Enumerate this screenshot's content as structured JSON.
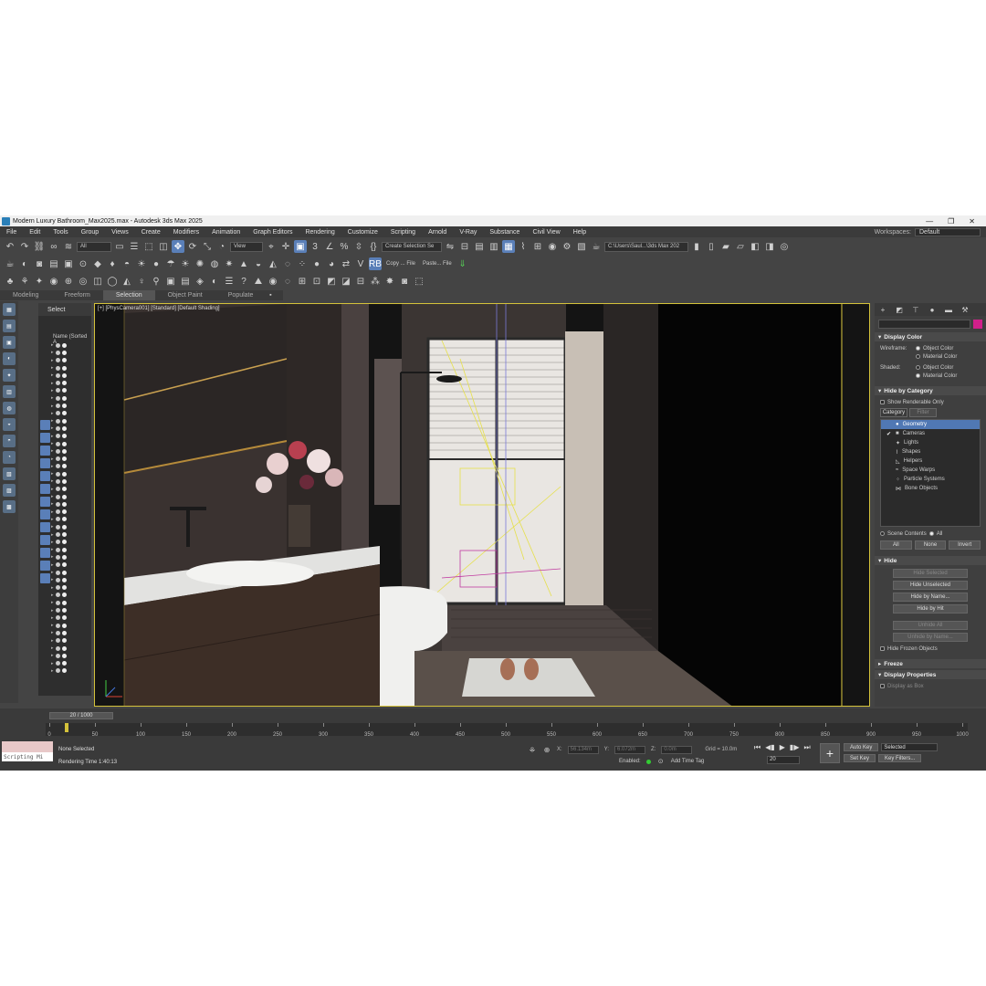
{
  "window": {
    "title": "Modern Luxury Bathroom_Max2025.max - Autodesk 3ds Max 2025",
    "minimize": "—",
    "maximize": "❐",
    "close": "✕"
  },
  "menu": {
    "items": [
      "File",
      "Edit",
      "Tools",
      "Group",
      "Views",
      "Create",
      "Modifiers",
      "Animation",
      "Graph Editors",
      "Rendering",
      "Customize",
      "Scripting",
      "Arnold",
      "V-Ray",
      "Substance",
      "Civil View",
      "Help"
    ],
    "workspaces_label": "Workspaces:",
    "workspaces_value": "Default"
  },
  "toolbar": {
    "selection_filter": "All",
    "reference_coord": "View",
    "named_selection": "Create Selection Se",
    "path": "C:\\Users\\Saul...\\3ds Max 202",
    "copy_label": "Copy ... File",
    "paste_label": "Paste... File",
    "rb_label": "RB"
  },
  "ribbon": {
    "tabs": [
      "Modeling",
      "Freeform",
      "Selection",
      "Object Paint",
      "Populate"
    ],
    "active": "Selection"
  },
  "scene_explorer": {
    "header": "Select",
    "column": "Name (Sorted A"
  },
  "viewport": {
    "label": "[+] [PhysCamera001] [Standard] [Default Shading]"
  },
  "command_panel": {
    "display_color": {
      "title": "Display Color",
      "wireframe_label": "Wireframe:",
      "shaded_label": "Shaded:",
      "object_color": "Object Color",
      "material_color": "Material Color"
    },
    "hide_by_category": {
      "title": "Hide by Category",
      "show_renderable": "Show Renderable Only",
      "tab_category": "Category",
      "tab_filter": "Filter",
      "items": [
        {
          "label": "Geometry",
          "checked": false,
          "selected": true,
          "icon": "●"
        },
        {
          "label": "Cameras",
          "checked": true,
          "selected": false,
          "icon": "■"
        },
        {
          "label": "Lights",
          "checked": false,
          "selected": false,
          "icon": "✦"
        },
        {
          "label": "Shapes",
          "checked": false,
          "selected": false,
          "icon": "⌇"
        },
        {
          "label": "Helpers",
          "checked": false,
          "selected": false,
          "icon": "◺"
        },
        {
          "label": "Space Warps",
          "checked": false,
          "selected": false,
          "icon": "≈"
        },
        {
          "label": "Particle Systems",
          "checked": false,
          "selected": false,
          "icon": "⁘"
        },
        {
          "label": "Bone Objects",
          "checked": false,
          "selected": false,
          "icon": "⋈"
        }
      ],
      "scene_contents": "Scene Contents",
      "all_radio": "All",
      "btn_all": "All",
      "btn_none": "None",
      "btn_invert": "Invert"
    },
    "hide": {
      "title": "Hide",
      "hide_selected": "Hide Selected",
      "hide_unselected": "Hide Unselected",
      "hide_by_name": "Hide by Name...",
      "hide_by_hit": "Hide by Hit",
      "unhide_all": "Unhide All",
      "unhide_by_name": "Unhide by Name...",
      "hide_frozen": "Hide Frozen Objects"
    },
    "freeze": {
      "title": "Freeze"
    },
    "display_properties": {
      "title": "Display Properties",
      "display_as_box": "Display as Box"
    }
  },
  "timeline": {
    "slider": "20 / 1000",
    "ticks": [
      "0",
      "50",
      "100",
      "150",
      "200",
      "250",
      "300",
      "350",
      "400",
      "450",
      "500",
      "550",
      "600",
      "650",
      "700",
      "750",
      "800",
      "850",
      "900",
      "950",
      "1000"
    ]
  },
  "status": {
    "maxscript": "Scripting Mi",
    "selection": "None Selected",
    "render_time": "Rendering Time  1:40:13",
    "x_label": "X:",
    "x_value": "56.134m",
    "y_label": "Y:",
    "y_value": "6.072m",
    "z_label": "Z:",
    "z_value": "0.0m",
    "grid": "Grid = 10.0m",
    "enabled": "Enabled:",
    "add_time_tag": "Add Time Tag",
    "frame": "20",
    "auto_key": "Auto Key",
    "set_key": "Set Key",
    "selected": "Selected",
    "key_filters": "Key Filters..."
  }
}
